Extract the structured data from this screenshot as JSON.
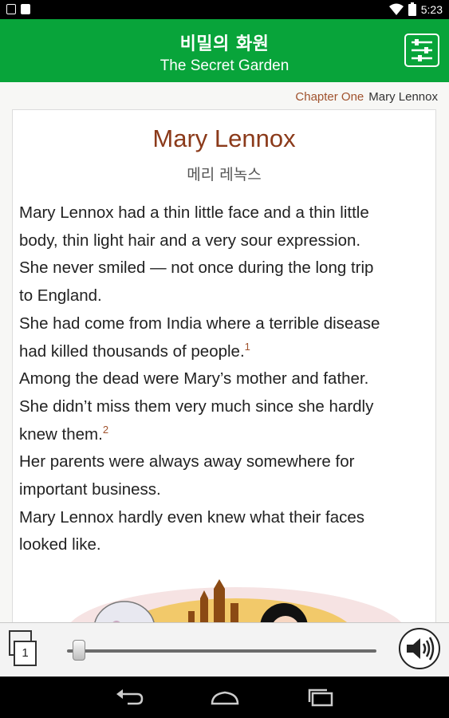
{
  "status_bar": {
    "time": "5:23",
    "icons": [
      "notification-box-icon",
      "sd-card-icon",
      "wifi-icon",
      "battery-icon"
    ]
  },
  "app_bar": {
    "title_ko": "비밀의 화원",
    "title_en": "The Secret Garden",
    "settings_icon": "settings-sliders-icon",
    "color": "#08a43a"
  },
  "chapter": {
    "label": "Chapter One",
    "name": "Mary Lennox",
    "title": "Mary Lennox",
    "subtitle": "메리 레녹스",
    "accent": "#8b3a1a"
  },
  "body": {
    "lines": [
      "Mary Lennox had a thin little face and a thin little",
      "body, thin light hair and a very sour expression.",
      "She never smiled — not once during the long trip",
      "to England.",
      "She had come from India where a terrible disease",
      "had killed thousands of people.",
      "Among the dead were Mary’s mother and father.",
      "She didn’t miss them very much since she hardly",
      "knew them.",
      "Her parents were always away somewhere for",
      "important business.",
      "Mary Lennox hardly even knew what their faces",
      "looked like."
    ],
    "footnote_1": "1",
    "footnote_2": "2"
  },
  "controls": {
    "page_number": "1",
    "progress": 0.02,
    "audio_icon": "speaker-icon"
  },
  "nav_bar": {
    "icons": [
      "back-icon",
      "home-icon",
      "recent-apps-icon"
    ]
  }
}
